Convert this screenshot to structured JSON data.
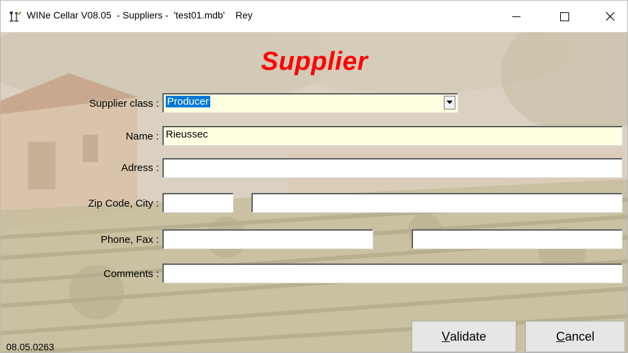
{
  "window": {
    "title": "WINe Cellar V08.05  - Suppliers -  'test01.mdb'    Rey",
    "icon": "wine-cellar-app-icon"
  },
  "form": {
    "heading": "Supplier",
    "heading_color": "#ff0000",
    "supplier_class": {
      "label": "Supplier class :",
      "value": "Producer"
    },
    "name": {
      "label": "Name :",
      "value": "Rieussec"
    },
    "address": {
      "label": "Adress :",
      "value": ""
    },
    "zip_city": {
      "label": "Zip Code, City :",
      "zip_value": "",
      "city_value": ""
    },
    "phone_fax": {
      "label": "Phone, Fax :",
      "phone_value": "",
      "fax_value": ""
    },
    "comments": {
      "label": "Comments :",
      "value": ""
    }
  },
  "buttons": {
    "validate_accel": "V",
    "validate_rest": "alidate",
    "cancel_accel": "C",
    "cancel_rest": "ancel"
  },
  "status": {
    "version": "08.05.0263"
  },
  "colors": {
    "field_highlight": "#ffffe1",
    "selection": "#0078d7"
  }
}
